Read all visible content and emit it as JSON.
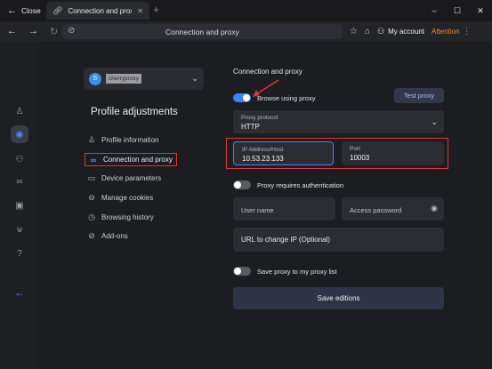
{
  "titlebar": {
    "close_label": "Close",
    "tab_title": "Connection and prox",
    "new_tab_symbol": "+",
    "window_controls": [
      "–",
      "☐",
      "✕"
    ]
  },
  "addressbar": {
    "url_text": "Connection and proxy",
    "account_label": "My account",
    "attention_label": "Attention",
    "icons": [
      "back-arrow-icon",
      "forward-arrow-icon",
      "reload-icon",
      "link-icon",
      "star-icon",
      "bell-icon",
      "user-icon",
      "more-icon"
    ]
  },
  "rail": {
    "icons": [
      "user-icon",
      "profiles-icon",
      "team-icon",
      "link-icon",
      "browser-window-icon",
      "basket-icon",
      "help-icon",
      "back-arrow-icon"
    ],
    "active_index": 1
  },
  "profile": {
    "avatar_letter": "S",
    "name": "cherryproxy",
    "heading": "Profile adjustments"
  },
  "menu": {
    "items": [
      {
        "label": "Profile information",
        "icon": "person-icon"
      },
      {
        "label": "Connection and proxy",
        "icon": "link-icon"
      },
      {
        "label": "Device parameters",
        "icon": "monitor-icon"
      },
      {
        "label": "Manage cookies",
        "icon": "cookie-icon"
      },
      {
        "label": "Browsing history",
        "icon": "history-icon"
      },
      {
        "label": "Add-ons",
        "icon": "check-circle-icon"
      }
    ],
    "active_index": 1
  },
  "proxy": {
    "section_title": "Connection and proxy",
    "browse_using_proxy_label": "Browse using proxy",
    "browse_using_proxy_on": true,
    "test_button": "Test proxy",
    "protocol_label": "Proxy protocol",
    "protocol_value": "HTTP",
    "ip_label": "IP Address/Host",
    "ip_value": "10.53.23.133",
    "port_label": "Port",
    "port_value": "10003",
    "auth_label": "Proxy requires authentication",
    "auth_on": false,
    "username_placeholder": "User name",
    "password_placeholder": "Access password",
    "change_ip_placeholder": "URL to change IP (Optional)",
    "save_to_list_label": "Save proxy to my proxy list",
    "save_to_list_on": false,
    "save_button": "Save editions"
  },
  "colors": {
    "accent_blue": "#3b82f6",
    "highlight_red": "#e0333c",
    "attention_orange": "#f28b2c",
    "background": "#1c1d20"
  }
}
